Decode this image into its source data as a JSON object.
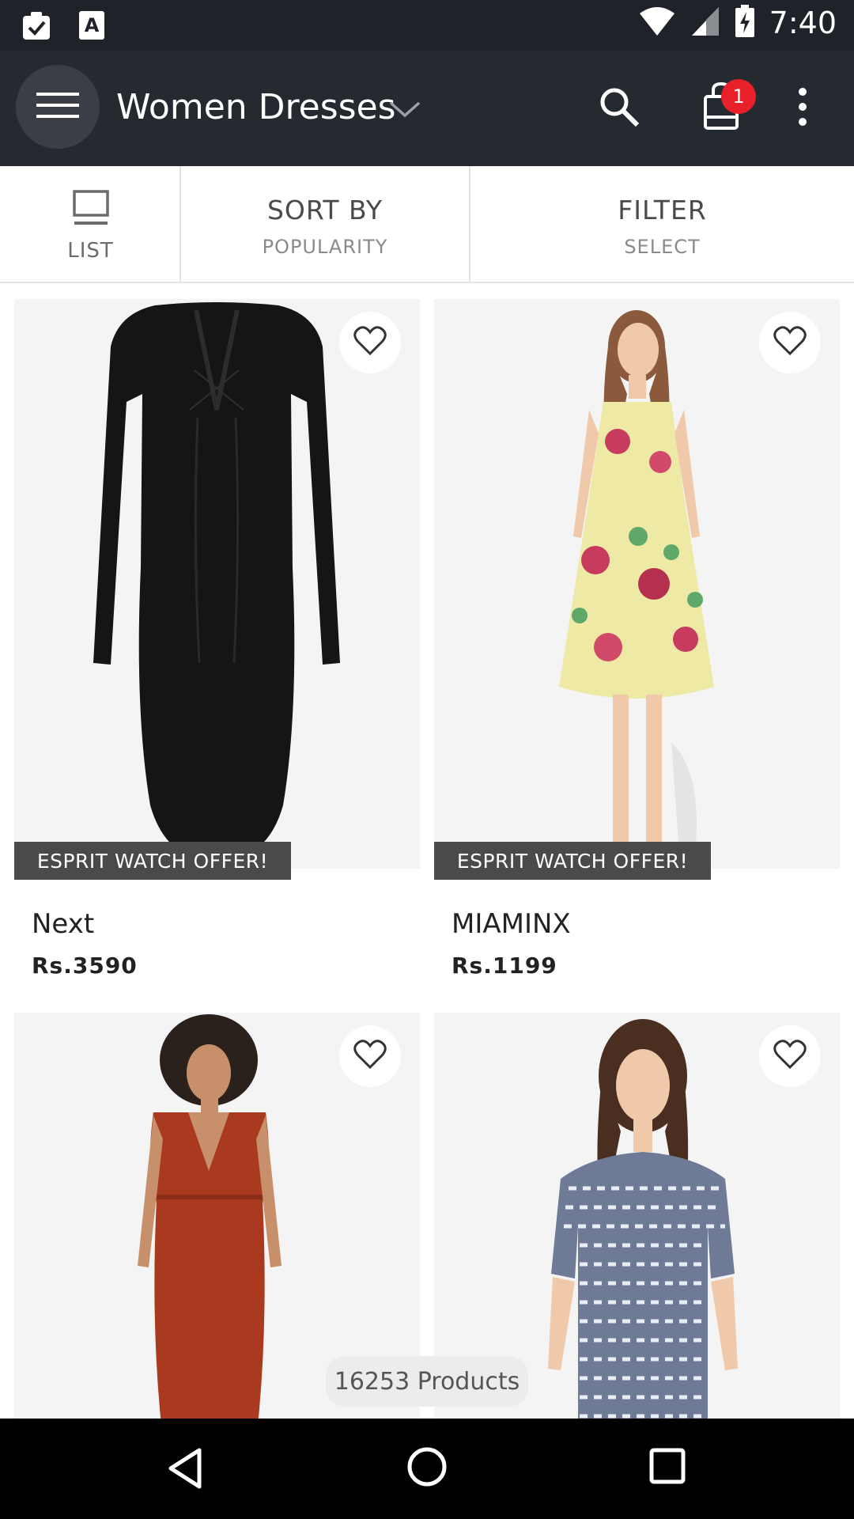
{
  "status_bar": {
    "time": "7:40",
    "icons": [
      "clipboard-check-icon",
      "font-a-icon",
      "wifi-icon",
      "signal-icon",
      "battery-charging-icon"
    ]
  },
  "app_bar": {
    "title": "Women Dresses",
    "cart_count": "1",
    "icons": [
      "menu-icon",
      "chevron-down-icon",
      "search-icon",
      "shopping-bag-icon",
      "more-vert-icon"
    ]
  },
  "toolbar": {
    "list_label": "LIST",
    "sort_label": "SORT BY",
    "sort_value": "POPULARITY",
    "filter_label": "FILTER",
    "filter_value": "SELECT"
  },
  "products": [
    {
      "brand": "Next",
      "price": "Rs.3590",
      "offer": "ESPRIT WATCH OFFER!"
    },
    {
      "brand": "MIAMINX",
      "price": "Rs.1199",
      "offer": "ESPRIT WATCH OFFER!"
    },
    {
      "brand": "",
      "price": "",
      "offer": ""
    },
    {
      "brand": "",
      "price": "",
      "offer": ""
    }
  ],
  "product_count": "16253 Products",
  "colors": {
    "app_bar": "#252a31",
    "status_bar": "#1f2329",
    "badge": "#e8202a",
    "offer_label": "#4a4a4a"
  }
}
